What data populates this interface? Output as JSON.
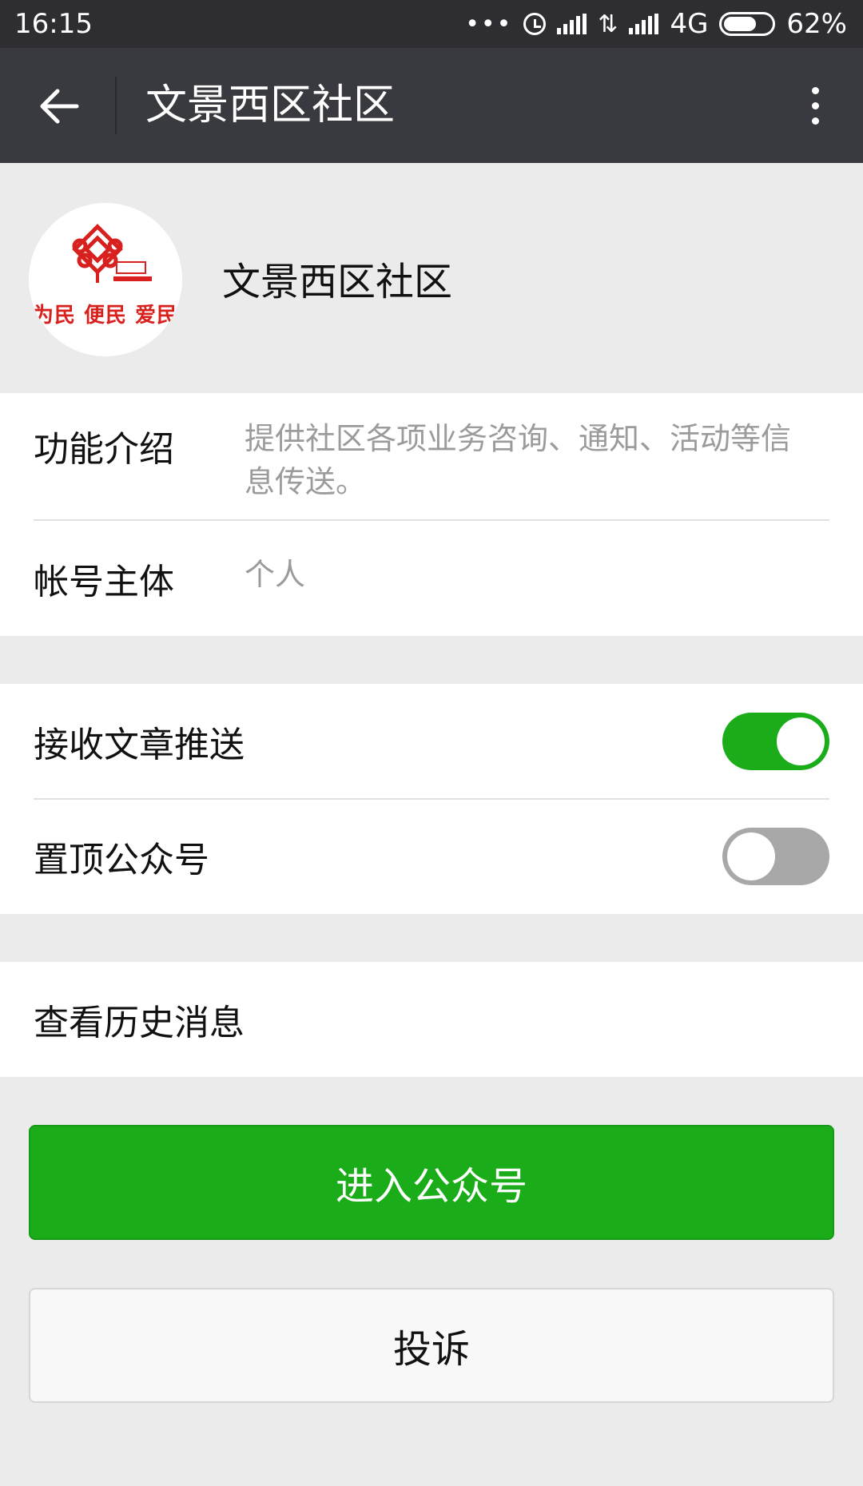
{
  "status_bar": {
    "time": "16:15",
    "network": "4G",
    "battery": "62%"
  },
  "nav": {
    "title": "文景西区社区"
  },
  "profile": {
    "name": "文景西区社区",
    "avatar_slogan": "为民 便民 爱民"
  },
  "info": {
    "intro_label": "功能介绍",
    "intro_value": "提供社区各项业务咨询、通知、活动等信息传送。",
    "account_label": "帐号主体",
    "account_value": "个人"
  },
  "settings": {
    "receive_label": "接收文章推送",
    "receive_on": true,
    "pin_label": "置顶公众号",
    "pin_on": false
  },
  "history": {
    "label": "查看历史消息"
  },
  "actions": {
    "enter_label": "进入公众号",
    "complain_label": "投诉"
  },
  "colors": {
    "accent": "#1aad19",
    "nav_bg": "#393a3f",
    "status_bg": "#2e2e32",
    "brand_red": "#d8201e"
  }
}
